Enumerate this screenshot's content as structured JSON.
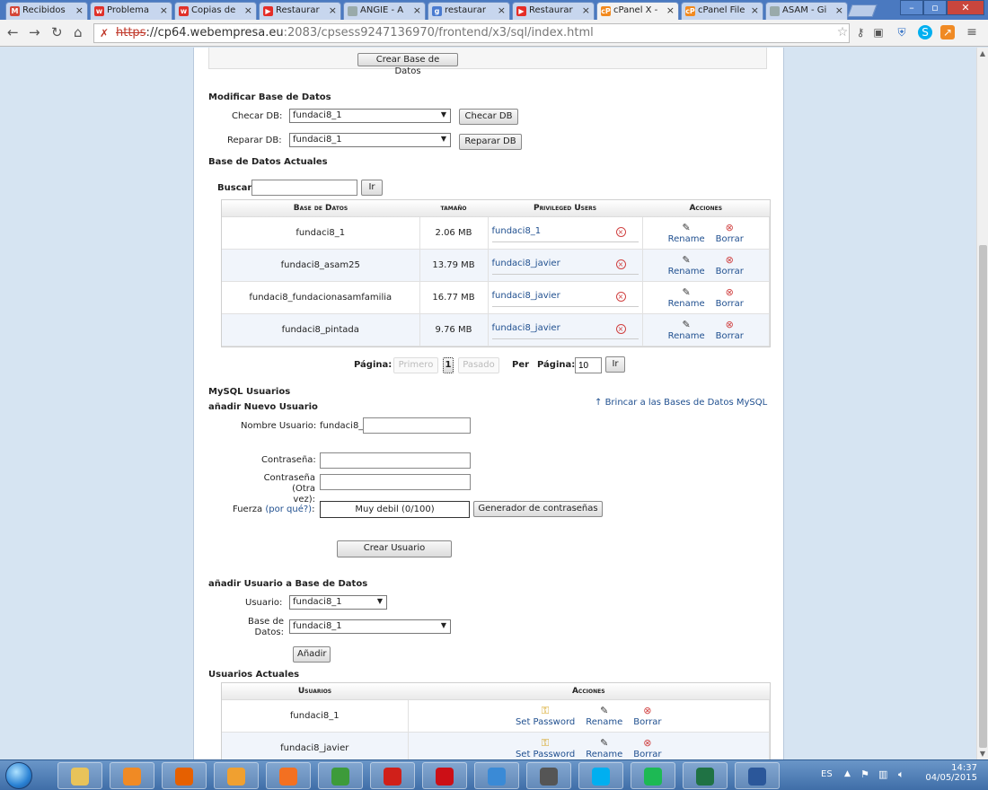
{
  "browser": {
    "tabs": [
      {
        "label": "Recibidos",
        "icon": "gmail-icon",
        "color": "#d44638",
        "glyph": "M"
      },
      {
        "label": "Problema",
        "icon": "webempresa-icon",
        "color": "#e0312a",
        "glyph": "w"
      },
      {
        "label": "Copias de",
        "icon": "webempresa-icon",
        "color": "#e0312a",
        "glyph": "w"
      },
      {
        "label": "Restaurar",
        "icon": "youtube-icon",
        "color": "#e52d27",
        "glyph": "▶"
      },
      {
        "label": "ANGIE - A",
        "icon": "page-icon",
        "color": "#9aa",
        "glyph": ""
      },
      {
        "label": "restaurar",
        "icon": "google-icon",
        "color": "#4a7bd0",
        "glyph": "g"
      },
      {
        "label": "Restaurar",
        "icon": "youtube-icon",
        "color": "#e52d27",
        "glyph": "▶"
      },
      {
        "label": "cPanel X -",
        "icon": "cpanel-icon",
        "color": "#f28a1f",
        "glyph": "cP",
        "active": true
      },
      {
        "label": "cPanel File",
        "icon": "cpanel-icon",
        "color": "#f28a1f",
        "glyph": "cP"
      },
      {
        "label": "ASAM - Gi",
        "icon": "page-icon",
        "color": "#9aa",
        "glyph": ""
      }
    ],
    "url_scheme": "https",
    "url_host": "://cp64.webempresa.eu",
    "url_path": ":2083/cpsess9247136970/frontend/x3/sql/index.html"
  },
  "top": {
    "crear_db_button": "Crear Base de Datos"
  },
  "modify": {
    "title": "Modificar Base de Datos",
    "check_label": "Checar DB:",
    "check_value": "fundaci8_1",
    "check_button": "Checar DB",
    "repair_label": "Reparar DB:",
    "repair_value": "fundaci8_1",
    "repair_button": "Reparar DB"
  },
  "current_dbs": {
    "title": "Base de Datos Actuales",
    "search_label": "Buscar",
    "search_button": "Ir",
    "headers": [
      "Base de Datos",
      "tamaño",
      "Privileged Users",
      "Acciones"
    ],
    "rows": [
      {
        "name": "fundaci8_1",
        "size": "2.06 MB",
        "user": "fundaci8_1"
      },
      {
        "name": "fundaci8_asam25",
        "size": "13.79 MB",
        "user": "fundaci8_javier"
      },
      {
        "name": "fundaci8_fundacionasamfamilia",
        "size": "16.77 MB",
        "user": "fundaci8_javier"
      },
      {
        "name": "fundaci8_pintada",
        "size": "9.76 MB",
        "user": "fundaci8_javier"
      }
    ],
    "rename_label": "Rename",
    "delete_label": "Borrar"
  },
  "pagination": {
    "page_label": "Página:",
    "first": "Primero",
    "current": "1",
    "last": "Pasado",
    "per_label": "Per",
    "per_page_label": "Página:",
    "per_value": "10",
    "go_button": "Ir"
  },
  "mysql_users": {
    "title": "MySQL Usuarios",
    "add_title": "añadir Nuevo Usuario",
    "jump_link": "Brincar a las Bases de Datos MySQL",
    "username_label": "Nombre Usuario:",
    "username_prefix": "fundaci8_",
    "password_label": "Contraseña:",
    "password2_label_1": "Contraseña (Otra",
    "password2_label_2": "vez):",
    "strength_label": "Fuerza",
    "strength_link": "(por qué?)",
    "strength_colon": ":",
    "strength_value": "Muy debil (0/100)",
    "generator_button": "Generador de contraseñas",
    "create_button": "Crear Usuario"
  },
  "add_user_db": {
    "title": "añadir Usuario a Base de Datos",
    "user_label": "Usuario:",
    "user_value": "fundaci8_1",
    "db_label_1": "Base de",
    "db_label_2": "Datos:",
    "db_value": "fundaci8_1",
    "add_button": "Añadir"
  },
  "current_users": {
    "title": "Usuarios Actuales",
    "headers": [
      "Usuarios",
      "Acciones"
    ],
    "rows": [
      {
        "name": "fundaci8_1"
      },
      {
        "name": "fundaci8_javier"
      }
    ],
    "set_password_label": "Set Password",
    "rename_label": "Rename",
    "delete_label": "Borrar"
  },
  "taskbar": {
    "lang": "ES",
    "time": "14:37",
    "date": "04/05/2015",
    "apps": [
      {
        "icon": "file-explorer-icon",
        "color": "#e8c35a"
      },
      {
        "icon": "media-player-icon",
        "color": "#f08a24"
      },
      {
        "icon": "firefox-icon",
        "color": "#e66000"
      },
      {
        "icon": "outlook-icon",
        "color": "#f0a030"
      },
      {
        "icon": "xampp-icon",
        "color": "#f37021"
      },
      {
        "icon": "chrome-icon",
        "color": "#3d9b3a"
      },
      {
        "icon": "splat-app-icon",
        "color": "#d0201a"
      },
      {
        "icon": "opera-icon",
        "color": "#cc0f16"
      },
      {
        "icon": "safari-icon",
        "color": "#3a8ad6"
      },
      {
        "icon": "ubuntu-vm-icon",
        "color": "#555"
      },
      {
        "icon": "skype-icon",
        "color": "#00aff0"
      },
      {
        "icon": "spotify-icon",
        "color": "#1db954"
      },
      {
        "icon": "excel-icon",
        "color": "#1f7244"
      },
      {
        "icon": "word-icon",
        "color": "#2b579a"
      }
    ]
  }
}
